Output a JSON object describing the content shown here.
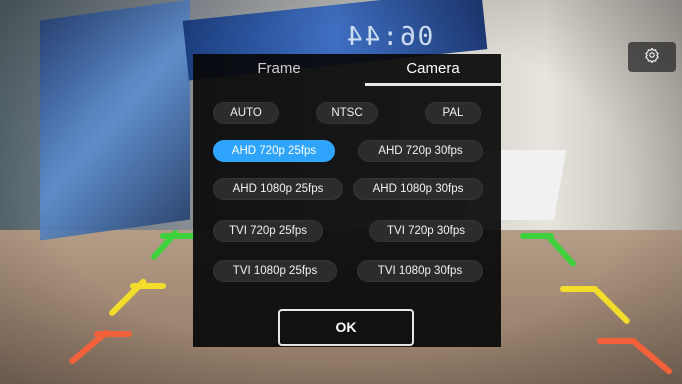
{
  "clock": {
    "time": "06:44"
  },
  "settings_button": {
    "icon": "gear-icon"
  },
  "dialog": {
    "tabs": [
      {
        "label": "Frame",
        "active": false
      },
      {
        "label": "Camera",
        "active": true
      }
    ],
    "standard_options": [
      {
        "label": "AUTO",
        "selected": false
      },
      {
        "label": "NTSC",
        "selected": false
      },
      {
        "label": "PAL",
        "selected": false
      }
    ],
    "format_options": [
      {
        "label": "AHD 720p 25fps",
        "selected": true
      },
      {
        "label": "AHD 720p 30fps",
        "selected": false
      },
      {
        "label": "AHD 1080p 25fps",
        "selected": false
      },
      {
        "label": "AHD 1080p 30fps",
        "selected": false
      },
      {
        "label": "TVI 720p 25fps",
        "selected": false
      },
      {
        "label": "TVI 720p 30fps",
        "selected": false
      },
      {
        "label": "TVI 1080p 25fps",
        "selected": false
      },
      {
        "label": "TVI 1080p 30fps",
        "selected": false
      }
    ],
    "ok_label": "OK"
  },
  "colors": {
    "selected": "#2ea4ff",
    "guide_green": "#3fd13c",
    "guide_yellow": "#f3dc2a",
    "guide_red": "#f2613a"
  }
}
